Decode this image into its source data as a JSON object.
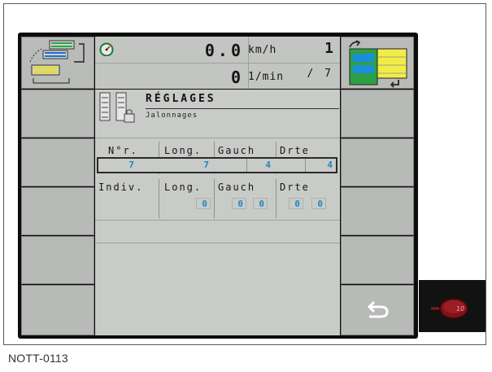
{
  "header": {
    "speed_value": "0.0",
    "speed_unit": "km/h",
    "rpm_value": "0",
    "rpm_unit": "1/min",
    "count_value": "1",
    "count_sub": "/ 7"
  },
  "page": {
    "title": "RÉGLAGES",
    "subtitle": "Jalonnages"
  },
  "table": {
    "headers": [
      "N°r.",
      "Long.",
      "Gauch",
      "Drte"
    ],
    "selected_row": {
      "nr": "7",
      "long": "7",
      "gauch": "4",
      "drte": "4"
    },
    "indiv_headers": [
      "Indiv.",
      "Long.",
      "Gauch",
      "Drte"
    ],
    "indiv_values": [
      "0",
      "0",
      "0",
      "0",
      "0"
    ]
  },
  "footer": {
    "pedal_label": "10"
  },
  "caption": "NOTT-0113",
  "colors": {
    "value_blue": "#1e86c8",
    "panel_gray": "#c9cbc8"
  }
}
